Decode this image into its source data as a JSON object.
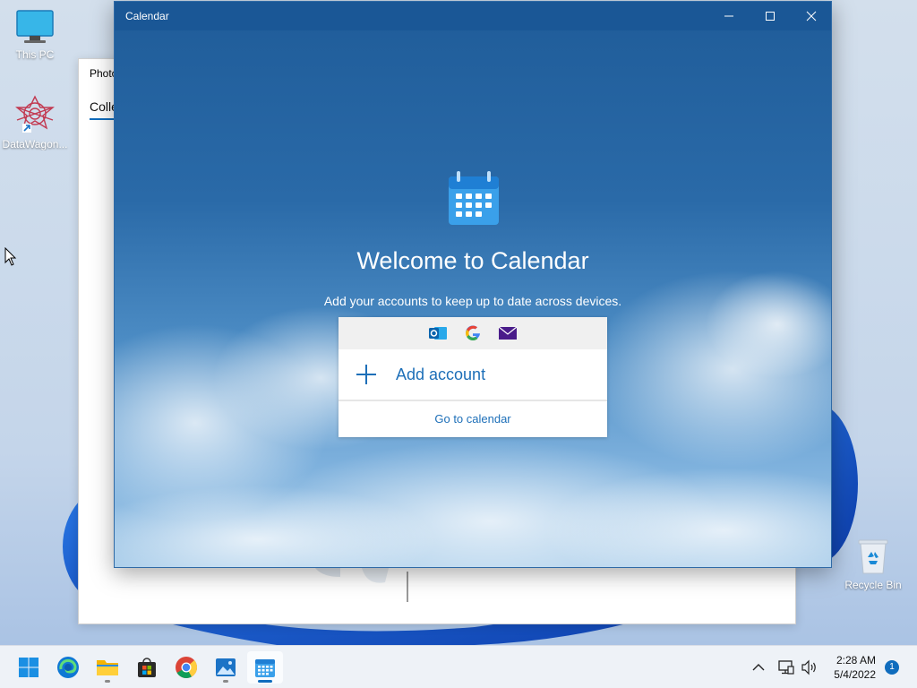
{
  "desktop": {
    "icons": [
      {
        "label": "This PC",
        "icon": "monitor-icon"
      },
      {
        "label": "DataWagon...",
        "icon": "datawagon-icon"
      },
      {
        "label": "Recycle Bin",
        "icon": "recycle-bin-icon"
      }
    ]
  },
  "photos_window": {
    "title": "Photo",
    "tab": "Colle"
  },
  "calendar_window": {
    "title": "Calendar",
    "controls": {
      "minimize": "minimize-icon",
      "maximize": "maximize-icon",
      "close": "close-icon"
    },
    "welcome_title": "Welcome to Calendar",
    "subtitle": "Add your accounts to keep up to date across devices.",
    "providers": [
      "outlook-icon",
      "google-icon",
      "mail-icon"
    ],
    "add_account_label": "Add account",
    "go_to_calendar_label": "Go to calendar",
    "accent_color": "#1d6fb8"
  },
  "taskbar": {
    "apps": [
      {
        "name": "start",
        "icon": "windows-logo-icon"
      },
      {
        "name": "edge",
        "icon": "edge-icon"
      },
      {
        "name": "file-explorer",
        "icon": "folder-icon",
        "running": true
      },
      {
        "name": "store",
        "icon": "store-icon"
      },
      {
        "name": "chrome",
        "icon": "chrome-icon"
      },
      {
        "name": "photos",
        "icon": "photos-icon",
        "running": true
      },
      {
        "name": "calendar",
        "icon": "calendar-icon",
        "active": true
      }
    ],
    "tray": {
      "chevron": "chevron-up-icon",
      "network": "network-icon",
      "volume": "volume-icon"
    },
    "clock": {
      "time": "2:28 AM",
      "date": "5/4/2022"
    },
    "notification_count": "1"
  }
}
